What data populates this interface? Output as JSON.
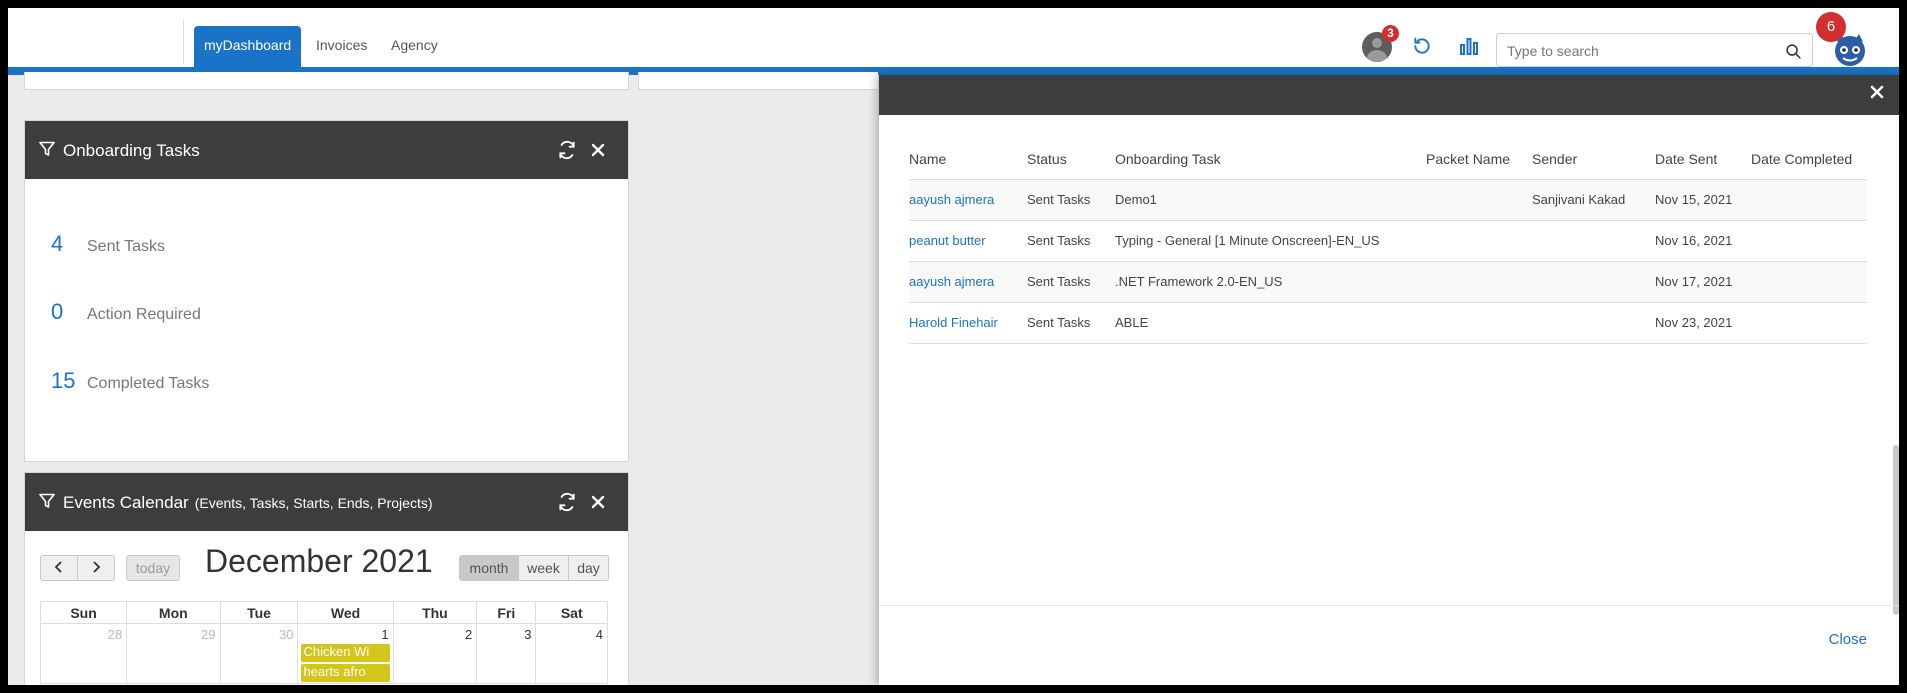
{
  "nav": {
    "tabs": [
      {
        "label": "myDashboard"
      },
      {
        "label": "Invoices"
      },
      {
        "label": "Agency"
      }
    ]
  },
  "topbar": {
    "notification_count": "3",
    "search_placeholder": "Type to search",
    "user_badge_count": "6"
  },
  "onboarding": {
    "title": "Onboarding Tasks",
    "stats": [
      {
        "value": "4",
        "label": "Sent Tasks"
      },
      {
        "value": "0",
        "label": "Action Required"
      },
      {
        "value": "15",
        "label": "Completed Tasks"
      }
    ]
  },
  "calendar": {
    "title": "Events Calendar",
    "subtitle": "(Events, Tasks, Starts, Ends, Projects)",
    "today_label": "today",
    "month_title": "December 2021",
    "view_buttons": [
      "month",
      "week",
      "day"
    ],
    "active_view": "month",
    "weekdays": [
      "Sun",
      "Mon",
      "Tue",
      "Wed",
      "Thu",
      "Fri",
      "Sat"
    ],
    "first_week": [
      "28",
      "29",
      "30",
      "1",
      "2",
      "3",
      "4"
    ],
    "events": [
      "Chicken Wi",
      "hearts afro"
    ]
  },
  "panel": {
    "columns": [
      "Name",
      "Status",
      "Onboarding Task",
      "Packet Name",
      "Sender",
      "Date Sent",
      "Date Completed"
    ],
    "rows": [
      {
        "name": "aayush ajmera",
        "status": "Sent Tasks",
        "task": "Demo1",
        "packet": "",
        "sender": "Sanjivani Kakad",
        "date_sent": "Nov 15, 2021",
        "date_completed": ""
      },
      {
        "name": "peanut butter",
        "status": "Sent Tasks",
        "task": "Typing - General [1 Minute Onscreen]-EN_US",
        "packet": "",
        "sender": "",
        "date_sent": "Nov 16, 2021",
        "date_completed": ""
      },
      {
        "name": "aayush ajmera",
        "status": "Sent Tasks",
        "task": ".NET Framework 2.0-EN_US",
        "packet": "",
        "sender": "",
        "date_sent": "Nov 17, 2021",
        "date_completed": ""
      },
      {
        "name": "Harold Finehair",
        "status": "Sent Tasks",
        "task": "ABLE",
        "packet": "",
        "sender": "",
        "date_sent": "Nov 23, 2021",
        "date_completed": ""
      }
    ],
    "close_label": "Close",
    "close_x": "×"
  },
  "colors": {
    "accent": "#1a73c6",
    "header_dark": "#3d3d3d",
    "badge_red": "#d32f2f",
    "event_yellow": "#d4c51a"
  },
  "icons": [
    "filter-icon",
    "refresh-icon",
    "close-icon",
    "bar-chart-icon",
    "search-icon",
    "chevron-left-icon",
    "chevron-right-icon"
  ]
}
